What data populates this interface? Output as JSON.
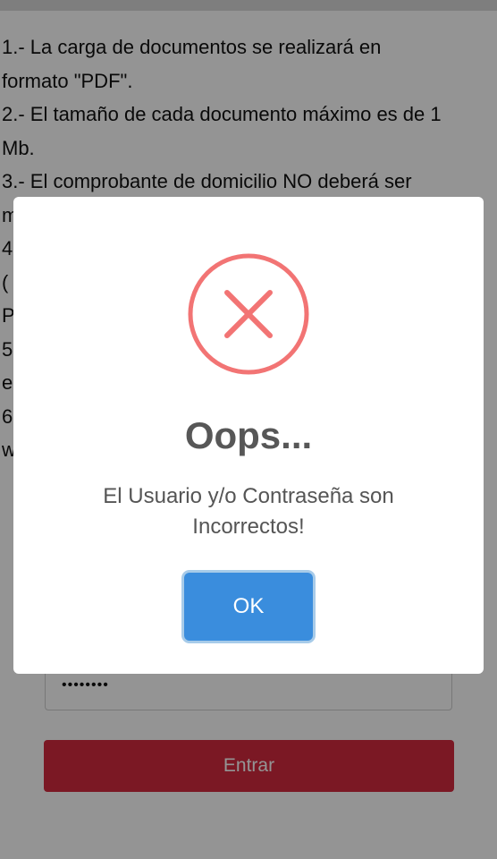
{
  "instructions": [
    "1.- La carga de documentos se realizará en",
    "formato \"PDF\".",
    "2.- El tamaño de cada documento máximo es de 1",
    "Mb.",
    "3.- El comprobante de domicilio NO deberá ser",
    "m",
    "4",
    "(",
    "P",
    "5",
    "e",
    "6",
    "w"
  ],
  "form": {
    "password_value": "••••••••",
    "submit_label": "Entrar"
  },
  "modal": {
    "title": "Oops...",
    "message_line1": "El Usuario y/o Contraseña son",
    "message_line2": "Incorrectos!",
    "ok_label": "OK",
    "icon": "error-x-icon"
  },
  "colors": {
    "error_icon": "#f27474",
    "ok_button": "#3a8ddd",
    "submit_button": "#d42a3e"
  }
}
